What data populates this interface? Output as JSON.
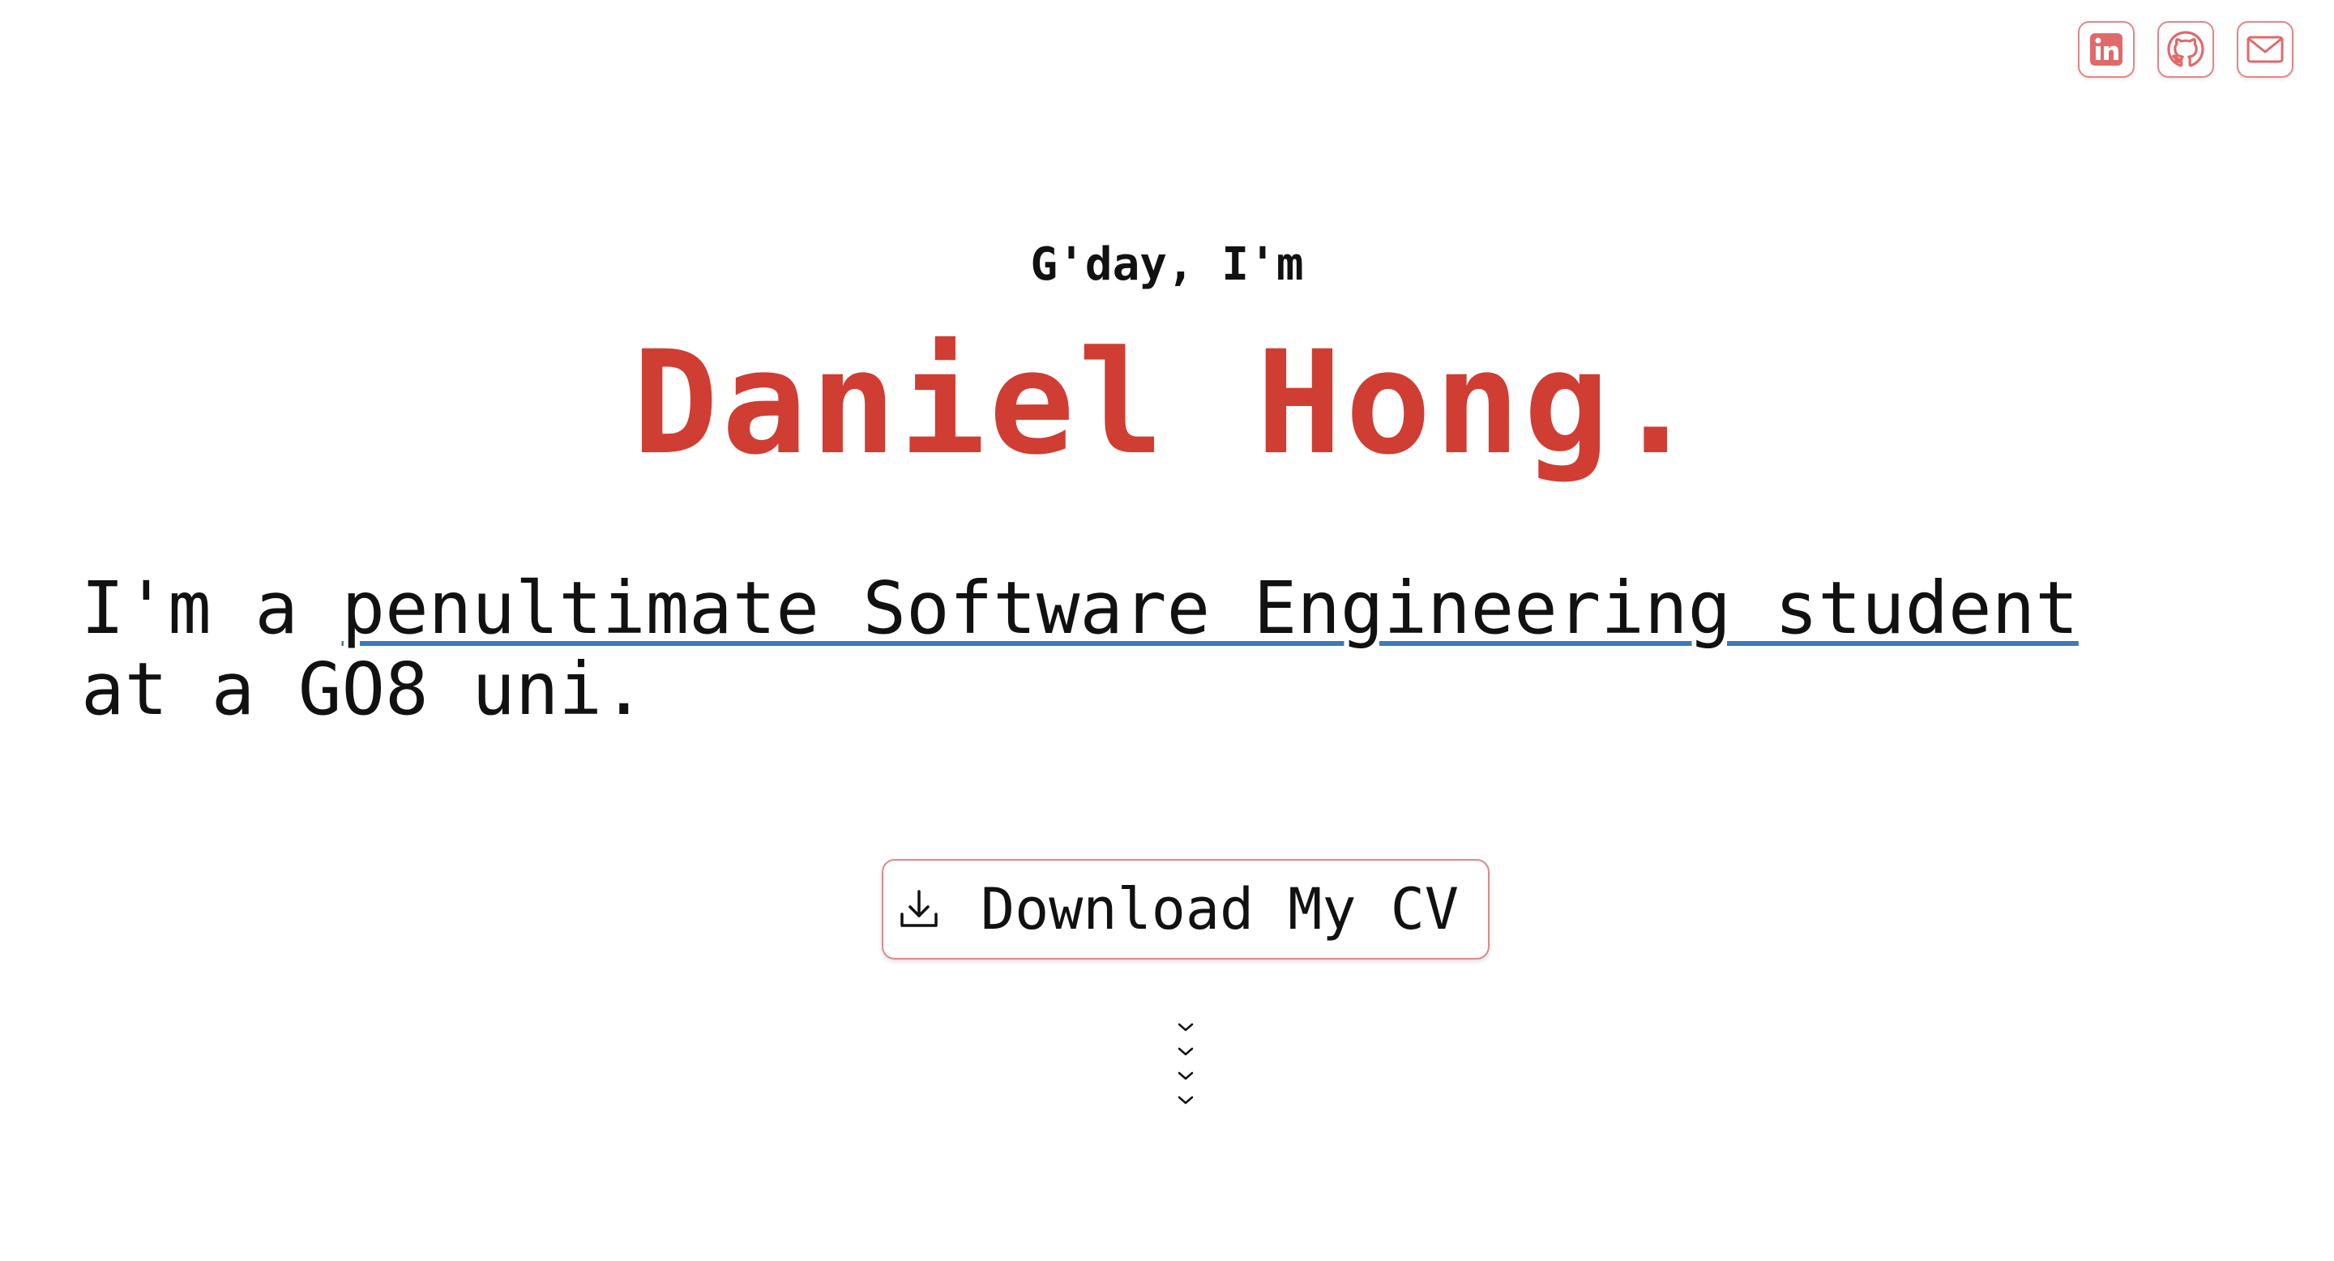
{
  "header": {
    "social_links": [
      {
        "icon": "linkedin-icon",
        "label": "LinkedIn"
      },
      {
        "icon": "github-icon",
        "label": "GitHub"
      },
      {
        "icon": "mail-icon",
        "label": "Email"
      }
    ]
  },
  "hero": {
    "greeting": "G'day, I'm",
    "name": "Daniel Hong.",
    "tagline_prefix": "I'm a ",
    "tagline_highlight": "penultimate Software Engineering student",
    "tagline_suffix": "at a GO8 uni."
  },
  "cv_button": {
    "label": "Download My CV",
    "icon": "download-icon"
  },
  "scroll_hint": {
    "icon": "chevrons-down-icon"
  },
  "colors": {
    "accent": "#cf3d33",
    "icon_accent": "#e06a6a",
    "underline": "#3d7ab8",
    "text": "#111111",
    "background": "#ffffff"
  }
}
